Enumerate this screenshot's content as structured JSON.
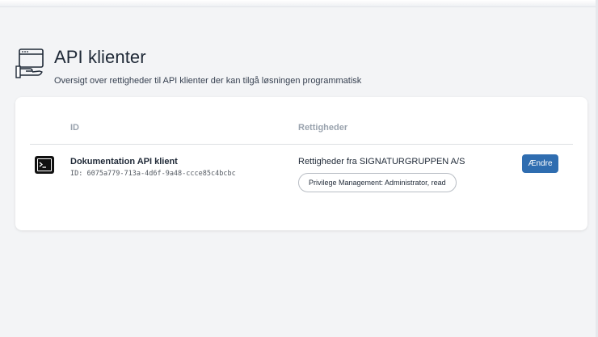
{
  "header": {
    "icon": "api-window-hand-icon",
    "title": "API klienter",
    "subtitle": "Oversigt over rettigheder til API klienter der kan tilgå løsningen programmatisk"
  },
  "table": {
    "columns": {
      "id": "ID",
      "rights": "Rettigheder"
    },
    "rows": [
      {
        "icon": "terminal-icon",
        "name": "Dokumentation API klient",
        "id_text": "ID: 6075a779-713a-4d6f-9a48-ccce85c4bcbc",
        "rights_text": "Rettigheder fra SIGNATURGRUPPEN A/S",
        "privilege": "Privilege Management: Administrator, read",
        "edit_label": "Ændre"
      }
    ]
  },
  "colors": {
    "background": "#f3f4f6",
    "card": "#ffffff",
    "accent": "#2f6db0",
    "header_text_muted": "#9aa3ae"
  }
}
